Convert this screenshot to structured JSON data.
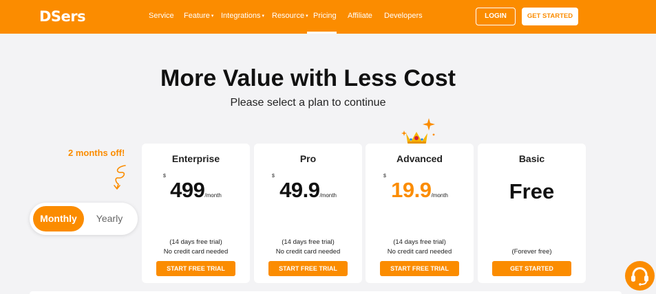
{
  "brand": {
    "name": "DSers",
    "accent": "#fb8c00"
  },
  "nav": {
    "items": [
      {
        "label": "Service",
        "dropdown": false
      },
      {
        "label": "Feature",
        "dropdown": true
      },
      {
        "label": "Integrations",
        "dropdown": true
      },
      {
        "label": "Resource",
        "dropdown": true
      },
      {
        "label": "Pricing",
        "dropdown": false,
        "active": true
      },
      {
        "label": "Affiliate",
        "dropdown": false
      },
      {
        "label": "Developers",
        "dropdown": false
      }
    ],
    "login_label": "LOGIN",
    "get_started_label": "GET STARTED"
  },
  "hero": {
    "title": "More Value with Less Cost",
    "subtitle": "Please select a plan to continue"
  },
  "billing": {
    "promo": "2 months off!",
    "options": [
      "Monthly",
      "Yearly"
    ],
    "selected": "Monthly"
  },
  "plans": [
    {
      "name": "Enterprise",
      "currency": "$",
      "price": "499",
      "period": "/month",
      "trial": "(14 days free trial)",
      "note": "No credit card needed",
      "cta": "START FREE TRIAL"
    },
    {
      "name": "Pro",
      "currency": "$",
      "price": "49.9",
      "period": "/month",
      "trial": "(14 days free trial)",
      "note": "No credit card needed",
      "cta": "START FREE TRIAL"
    },
    {
      "name": "Advanced",
      "currency": "$",
      "price": "19.9",
      "period": "/month",
      "trial": "(14 days free trial)",
      "note": "No credit card needed",
      "cta": "START FREE TRIAL",
      "highlight": true,
      "badge_icon": "crown-icon"
    },
    {
      "name": "Basic",
      "price": "Free",
      "note": "(Forever free)",
      "cta": "GET STARTED"
    }
  ],
  "icons": {
    "nav_caret": "▾",
    "support": "headset-icon"
  }
}
